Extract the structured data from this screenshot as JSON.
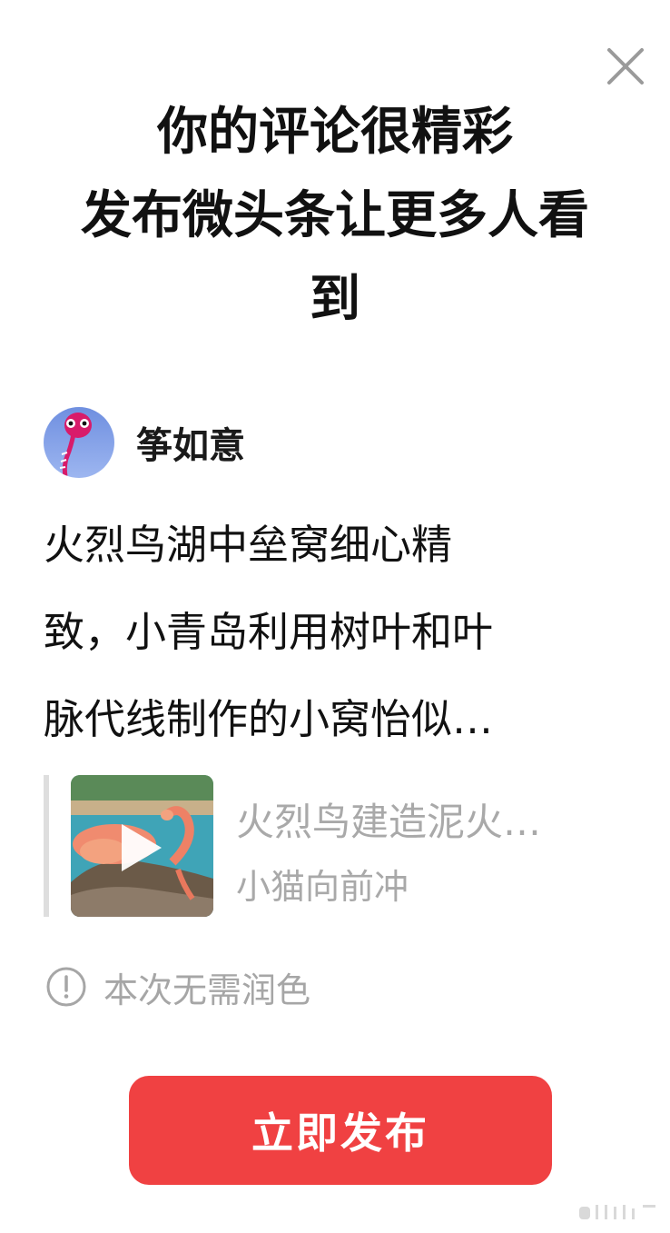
{
  "dialog": {
    "title_lines": [
      "你的评论很精彩",
      "发布微头条让更多人看",
      "到"
    ]
  },
  "author": {
    "name": "筝如意"
  },
  "post": {
    "lines": [
      "火烈鸟湖中垒窝细心精",
      "致，小青岛利用树叶和叶",
      "脉代线制作的小窝怡似…"
    ]
  },
  "quoted": {
    "title": "火烈鸟建造泥火…",
    "author": "小猫向前冲"
  },
  "notice": {
    "text": "本次无需润色"
  },
  "actions": {
    "publish_label": "立即发布"
  },
  "colors": {
    "accent": "#f04142",
    "muted_text": "#a9a9a9",
    "title_text": "#111111"
  },
  "icons": {
    "close": "close-icon",
    "info": "info-circle-icon",
    "play": "play-icon"
  }
}
